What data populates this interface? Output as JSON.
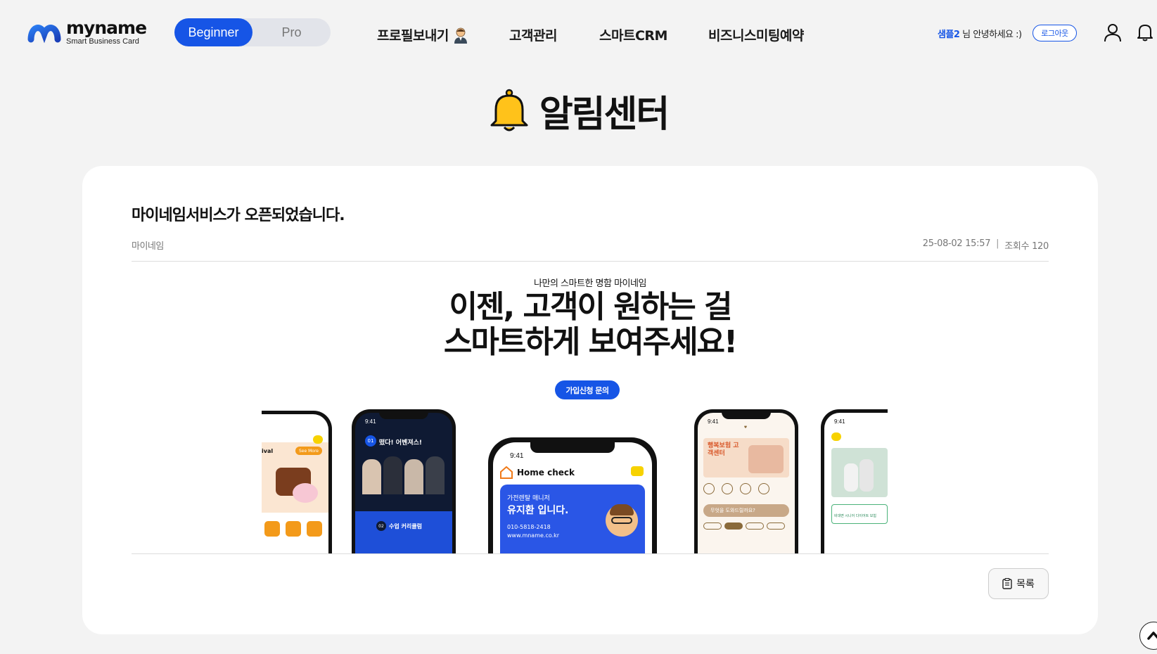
{
  "brand": {
    "name": "myname",
    "tagline": "Smart Business Card",
    "accent": "#1655e6"
  },
  "mode": {
    "active": "Beginner",
    "inactive": "Pro"
  },
  "nav": [
    {
      "label": "프로필보내기"
    },
    {
      "label": "고객관리"
    },
    {
      "label": "스마트CRM"
    },
    {
      "label": "비즈니스미팅예약"
    }
  ],
  "user": {
    "name": "샘플2",
    "greeting_suffix": " 님 안녕하세요 :)",
    "logout_label": "로그아웃"
  },
  "page": {
    "title": "알림센터"
  },
  "post": {
    "title": "마이네임서비스가 오픈되었습니다.",
    "author": "마이네임",
    "datetime": "25-08-02 15:57",
    "views_label": "조회수 120"
  },
  "banner": {
    "subtitle": "나만의 스마트한 명함 마이네임",
    "headline_line1": "이젠, 고객이 원하는 걸",
    "headline_line2": "스마트하게 보여주세요!",
    "cta_label": "가입신청 문의",
    "phones": {
      "p1_label": "ival",
      "p1_badge": "See More",
      "p2_title": "떴다! 어벤져스!",
      "p2_sub": "수업 커리큘럼",
      "p3_time": "9:41",
      "p3_app": "Home check",
      "p3_role": "가전렌탈 매니저",
      "p3_name": "유지환 입니다.",
      "p3_phone": "010-5818-2418",
      "p3_site": "www.mname.co.kr",
      "p4_title": "행복보험 고객센터",
      "p4_question": "무엇을 도와드릴까요?",
      "p5_text": "비대면 시니어 다이어트 보험",
      "time": "9:41"
    }
  },
  "actions": {
    "list_label": "목록"
  }
}
